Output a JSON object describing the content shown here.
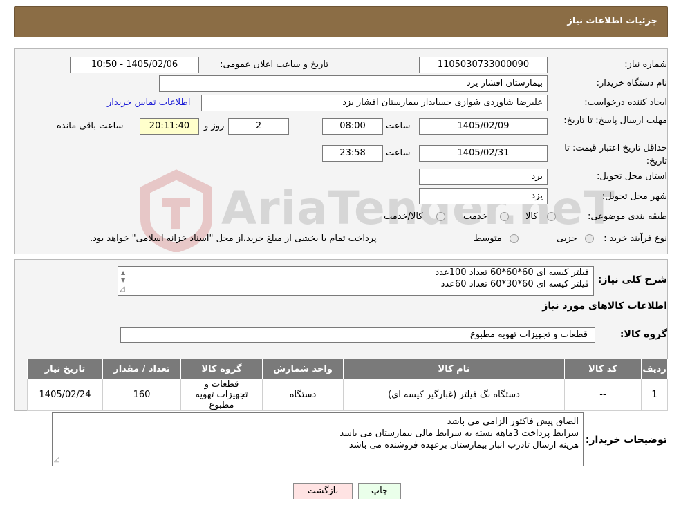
{
  "header": {
    "title": "جزئیات اطلاعات نیاز"
  },
  "form": {
    "need_number_label": "شماره نیاز:",
    "need_number": "1105030733000090",
    "announce_label": "تاریخ و ساعت اعلان عمومی:",
    "announce_value": "1405/02/06 - 10:50",
    "buyer_org_label": "نام دستگاه خریدار:",
    "buyer_org": "بیمارستان افشار یزد",
    "requester_label": "ایجاد کننده درخواست:",
    "requester": "علیرضا شاوردی شوازی حسابدار بیمارستان افشار یزد",
    "contact_link": "اطلاعات تماس خریدار",
    "reply_deadline_label": "مهلت ارسال پاسخ: تا تاریخ:",
    "reply_date": "1405/02/09",
    "time_label": "ساعت",
    "reply_time": "08:00",
    "days_value": "2",
    "days_label": "روز و",
    "remaining_time": "20:11:40",
    "remaining_label": "ساعت باقی مانده",
    "validity_label": "حداقل تاریخ اعتبار قیمت: تا تاریخ:",
    "validity_date": "1405/02/31",
    "validity_time": "23:58",
    "province_label": "استان محل تحویل:",
    "province": "یزد",
    "city_label": "شهر محل تحویل:",
    "city": "یزد",
    "category_label": "طبقه بندی موضوعی:",
    "category_options": [
      "کالا",
      "خدمت",
      "کالا/خدمت"
    ],
    "purchase_type_label": "نوع فرآیند خرید :",
    "purchase_options": [
      "جزیی",
      "متوسط"
    ],
    "purchase_note": "پرداخت تمام یا بخشی از مبلغ خرید،از محل \"اسناد خزانه اسلامی\" خواهد بود."
  },
  "summary": {
    "general_desc_label": "شرح کلی نیاز:",
    "general_desc_lines": [
      "فیلتر کیسه ای 60*60*60 تعداد 100عدد",
      "فیلتر کیسه ای 60*30*60 تعداد 60عدد"
    ],
    "goods_info_title": "اطلاعات کالاهای مورد نیاز",
    "goods_group_label": "گروه کالا:",
    "goods_group": "قطعات و تجهیزات تهویه مطبوع"
  },
  "table": {
    "headers": [
      "ردیف",
      "کد کالا",
      "نام کالا",
      "واحد شمارش",
      "گروه کالا",
      "تعداد / مقدار",
      "تاریخ نیاز"
    ],
    "rows": [
      [
        "1",
        "--",
        "دستگاه بگ فیلتر (غبارگیر کیسه ای)",
        "دستگاه",
        "قطعات و تجهیزات تهویه مطبوع",
        "160",
        "1405/02/24"
      ]
    ]
  },
  "buyer_notes": {
    "label": "توضیحات خریدار:",
    "lines": [
      "الصاق پیش فاکتور الزامی می باشد",
      "شرایط پرداخت 3ماهه بسته به شرایط مالی بیمارستان می باشد",
      "هزینه ارسال تادرب انبار بیمارستان برعهده فروشنده می باشد"
    ]
  },
  "buttons": {
    "print": "چاپ",
    "back": "بازگشت"
  },
  "watermark": {
    "text": "AriaTender.neT"
  },
  "colors": {
    "header_bg": "#8b6d45",
    "link": "#1a1ad6",
    "table_header": "#7a7a7a",
    "highlight": "#ffffcc",
    "back_button": "#ffe3e3",
    "print_button": "#eaffea"
  }
}
